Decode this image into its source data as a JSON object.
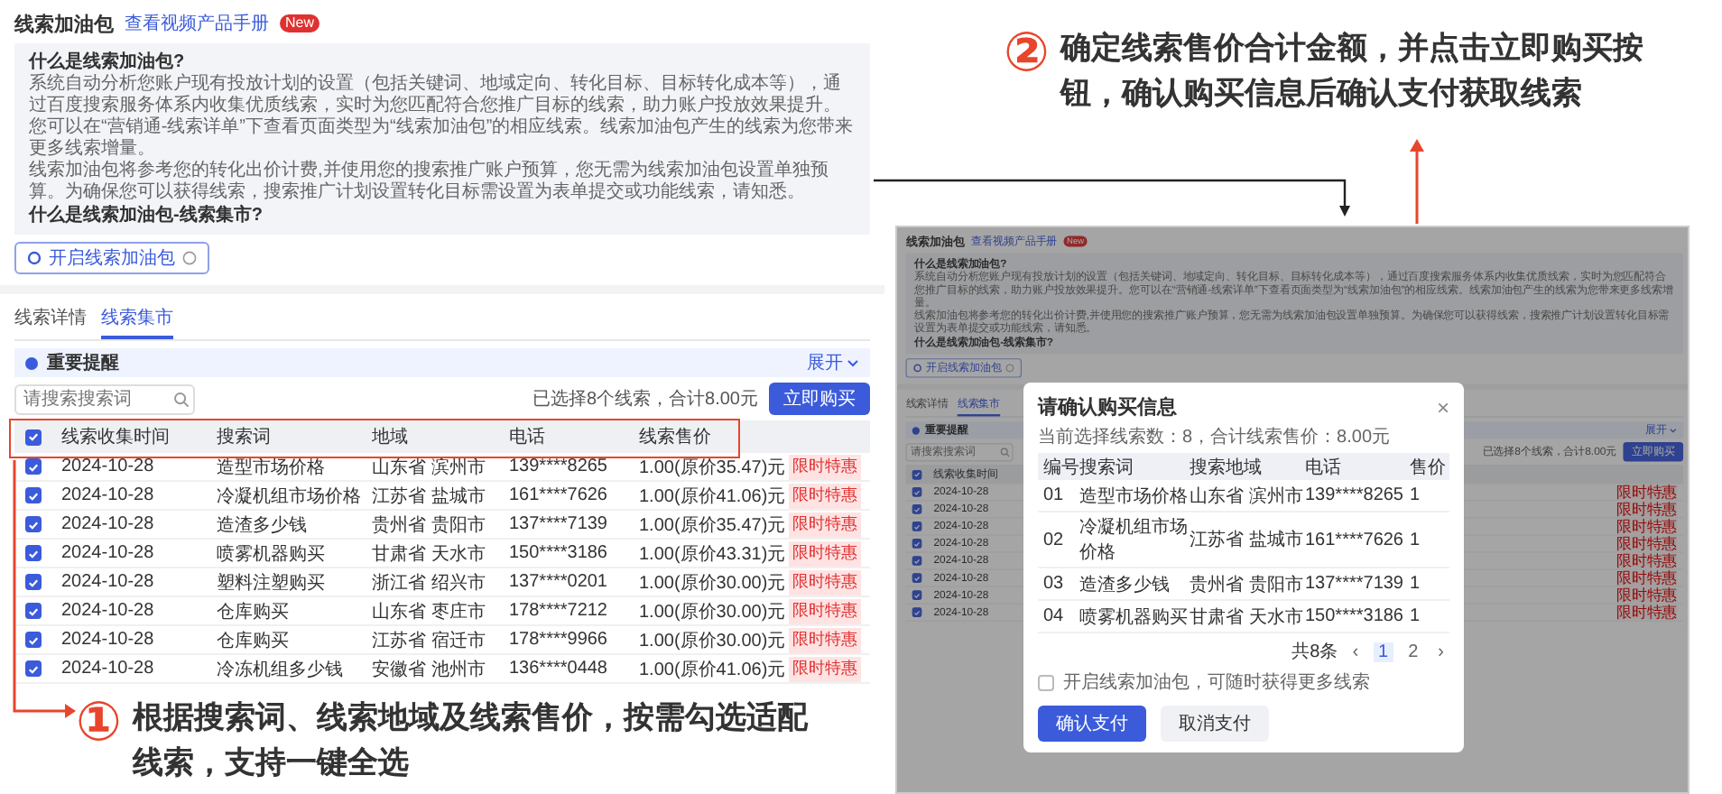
{
  "screen_1": {
    "title": "线索加油包",
    "manual_link": "查看视频产品手册",
    "badge": "New",
    "intro": {
      "heading": "什么是线索加油包?",
      "paragraphs": [
        "系统自动分析您账户现有投放计划的设置（包括关键词、地域定向、转化目标、目标转化成本等），通过百度搜索服务体系内收集优质线索，实时为您匹配符合您推广目标的线索，助力账户投放效果提升。您可以在“营销通-线索详单”下查看页面类型为“线索加油包”的相应线索。线索加油包产生的线索为您带来更多线索增量。",
        "线索加油包将参考您的转化出价计费,并使用您的搜索推广账户预算，您无需为线索加油包设置单独预算。为确保您可以获得线索，搜索推广计划设置转化目标需设置为表单提交或功能线索，请知悉。"
      ],
      "subheading": "什么是线索加油包-线索集市?"
    },
    "enable_button": "开启线索加油包",
    "tabs": [
      {
        "label": "线索详情",
        "selected": false
      },
      {
        "label": "线索集市",
        "selected": true
      }
    ],
    "notice": {
      "label": "重要提醒",
      "expand": "展开"
    },
    "search": {
      "placeholder": "请搜索搜索词"
    },
    "selection_summary": "已选择8个线索，合计8.00元",
    "buy_button": "立即购买",
    "table": {
      "select_all_checked": true,
      "columns": [
        "线索收集时间",
        "搜索词",
        "地域",
        "电话",
        "线索售价"
      ],
      "rows": [
        {
          "checked": true,
          "cells": [
            "2024-10-28",
            "造型市场价格",
            "山东省 滨州市",
            "139****8265",
            "1.00(原价35.47)元"
          ],
          "tag": "限时特惠"
        },
        {
          "checked": true,
          "cells": [
            "2024-10-28",
            "冷凝机组市场价格",
            "江苏省 盐城市",
            "161****7626",
            "1.00(原价41.06)元"
          ],
          "tag": "限时特惠"
        },
        {
          "checked": true,
          "cells": [
            "2024-10-28",
            "造渣多少钱",
            "贵州省 贵阳市",
            "137****7139",
            "1.00(原价35.47)元"
          ],
          "tag": "限时特惠"
        },
        {
          "checked": true,
          "cells": [
            "2024-10-28",
            "喷雾机器购买",
            "甘肃省 天水市",
            "150****3186",
            "1.00(原价43.31)元"
          ],
          "tag": "限时特惠"
        },
        {
          "checked": true,
          "cells": [
            "2024-10-28",
            "塑料注塑购买",
            "浙江省 绍兴市",
            "137****0201",
            "1.00(原价30.00)元"
          ],
          "tag": "限时特惠"
        },
        {
          "checked": true,
          "cells": [
            "2024-10-28",
            "仓库购买",
            "山东省 枣庄市",
            "178****7212",
            "1.00(原价30.00)元"
          ],
          "tag": "限时特惠"
        },
        {
          "checked": true,
          "cells": [
            "2024-10-28",
            "仓库购买",
            "江苏省 宿迁市",
            "178****9966",
            "1.00(原价30.00)元"
          ],
          "tag": "限时特惠"
        },
        {
          "checked": true,
          "cells": [
            "2024-10-28",
            "冷冻机组多少钱",
            "安徽省 池州市",
            "136****0448",
            "1.00(原价41.06)元"
          ],
          "tag": "限时特惠"
        }
      ]
    }
  },
  "annotation_1": {
    "number": "①",
    "text": "根据搜索词、线索地域及线索售价，按需勾选适配线索，支持一键全选"
  },
  "annotation_2": {
    "number": "②",
    "text": "确定线索售价合计金额，并点击立即购买按钮，确认购买信息后确认支付获取线索"
  },
  "screen_2": {
    "page": {
      "title": "线索加油包",
      "manual_link": "查看视频产品手册",
      "badge": "New",
      "intro": {
        "heading": "什么是线索加油包?",
        "paragraphs": [
          "系统自动分析您账户现有投放计划的设置（包括关键词、地域定向、转化目标、目标转化成本等），通过百度搜索服务体系内收集优质线索，实时为您匹配符合您推广目标的线索，助力账户投放效果提升。您可以在“营销通-线索详单”下查看页面类型为“线索加油包”的相应线索。线索加油包产生的线索为您带来更多线索增量。",
          "线索加油包将参考您的转化出价计费,并使用您的搜索推广账户预算，您无需为线索加油包设置单独预算。为确保您可以获得线索，搜索推广计划设置转化目标需设置为表单提交或功能线索，请知悉。"
        ],
        "subheading": "什么是线索加油包-线索集市?"
      },
      "enable_button": "开启线索加油包",
      "tabs": [
        {
          "label": "线索详情",
          "selected": false
        },
        {
          "label": "线索集市",
          "selected": true
        }
      ],
      "notice": {
        "label": "重要提醒",
        "expand": "展开"
      },
      "search": {
        "placeholder": "请搜索搜索词"
      },
      "selection_summary": "已选择8个线索，合计8.00元",
      "buy_button": "立即购买",
      "table": {
        "select_all_checked": true,
        "columns": [
          "线索收集时间"
        ],
        "rows": [
          {
            "checked": true,
            "date": "2024-10-28",
            "tag": "限时特惠"
          },
          {
            "checked": true,
            "date": "2024-10-28",
            "tag": "限时特惠"
          },
          {
            "checked": true,
            "date": "2024-10-28",
            "tag": "限时特惠"
          },
          {
            "checked": true,
            "date": "2024-10-28",
            "tag": "限时特惠"
          },
          {
            "checked": true,
            "date": "2024-10-28",
            "tag": "限时特惠"
          },
          {
            "checked": true,
            "date": "2024-10-28",
            "tag": "限时特惠"
          },
          {
            "checked": true,
            "date": "2024-10-28",
            "tag": "限时特惠"
          },
          {
            "checked": true,
            "date": "2024-10-28",
            "tag": "限时特惠"
          }
        ]
      }
    },
    "dialog": {
      "title": "请确认购买信息",
      "close": "×",
      "summary": "当前选择线索数：8，合计线索售价：8.00元",
      "columns": [
        "编号",
        "搜索词",
        "搜索地域",
        "电话",
        "售价"
      ],
      "rows": [
        {
          "cells": [
            "01",
            "造型市场价格",
            "山东省 滨州市",
            "139****8265",
            "1"
          ]
        },
        {
          "cells": [
            "02",
            "冷凝机组市场价格",
            "江苏省 盐城市",
            "161****7626",
            "1"
          ]
        },
        {
          "cells": [
            "03",
            "造渣多少钱",
            "贵州省 贵阳市",
            "137****7139",
            "1"
          ]
        },
        {
          "cells": [
            "04",
            "喷雾机器购买",
            "甘肃省 天水市",
            "150****3186",
            "1"
          ]
        }
      ],
      "pagination": {
        "total": "共8条",
        "prev": "‹",
        "pages": [
          {
            "label": "1",
            "selected": true
          },
          {
            "label": "2",
            "selected": false
          }
        ],
        "next": "›"
      },
      "opt_in": {
        "label": "开启线索加油包，可随时获得更多线索",
        "checked": false
      },
      "confirm_button": "确认支付",
      "cancel_button": "取消支付"
    }
  }
}
